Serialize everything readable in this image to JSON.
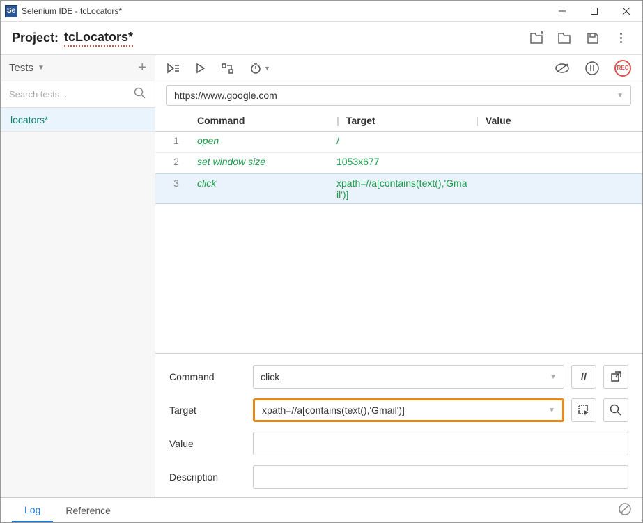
{
  "window": {
    "app_icon_text": "Se",
    "title": "Selenium IDE - tcLocators*"
  },
  "project": {
    "label": "Project:",
    "name": "tcLocators*"
  },
  "sidebar": {
    "dropdown_label": "Tests",
    "search_placeholder": "Search tests...",
    "tests": [
      {
        "name": "locators*"
      }
    ]
  },
  "toolbar": {
    "rec_label": "REC"
  },
  "url": {
    "value": "https://www.google.com"
  },
  "grid": {
    "headers": {
      "command": "Command",
      "target": "Target",
      "value": "Value"
    },
    "rows": [
      {
        "num": "1",
        "command": "open",
        "target": "/",
        "value": "",
        "selected": false
      },
      {
        "num": "2",
        "command": "set window size",
        "target": "1053x677",
        "value": "",
        "selected": false
      },
      {
        "num": "3",
        "command": "click",
        "target": "xpath=//a[contains(text(),'Gmail')]",
        "value": "",
        "selected": true
      }
    ]
  },
  "editor": {
    "labels": {
      "command": "Command",
      "target": "Target",
      "value": "Value",
      "description": "Description"
    },
    "command_value": "click",
    "command_toggle_text": "//",
    "target_value": "xpath=//a[contains(text(),'Gmail')]",
    "value_value": "",
    "description_value": ""
  },
  "footer": {
    "tabs": {
      "log": "Log",
      "reference": "Reference"
    }
  }
}
